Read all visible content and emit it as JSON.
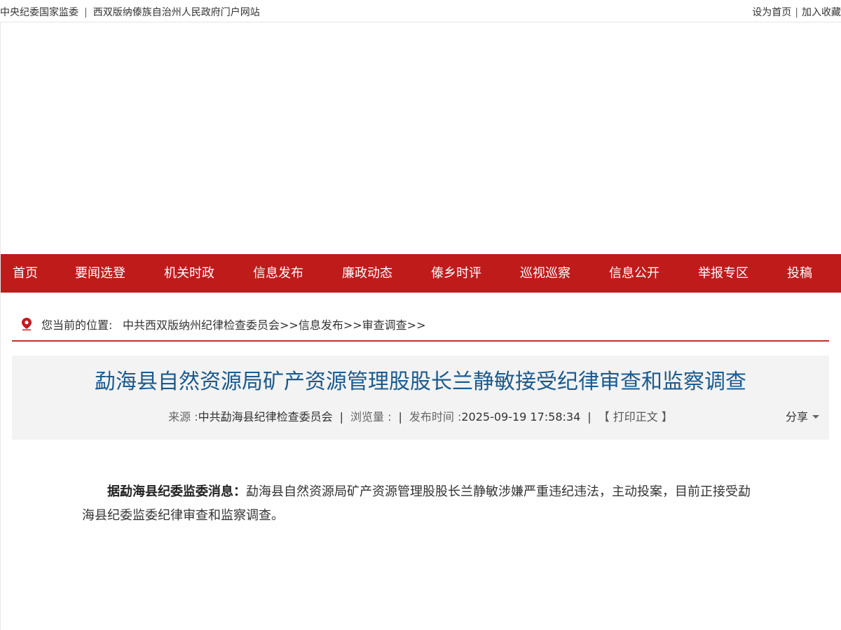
{
  "topbar": {
    "link1": "中央纪委国家监委",
    "separator": "|",
    "link2": "西双版纳傣族自治州人民政府门户网站",
    "set_home": "设为首页",
    "right_sep": "|",
    "add_fav": "加入收藏"
  },
  "nav": {
    "items": [
      "首页",
      "要闻选登",
      "机关时政",
      "信息发布",
      "廉政动态",
      "傣乡时评",
      "巡视巡察",
      "信息公开",
      "举报专区",
      "投稿"
    ]
  },
  "breadcrumb": {
    "label": "您当前的位置:",
    "items": [
      "中共西双版纳州纪律检查委员会",
      "信息发布",
      "审查调查"
    ],
    "sep": ">>"
  },
  "article": {
    "title": "勐海县自然资源局矿产资源管理股股长兰静敏接受纪律审查和监察调查",
    "source_label": "来源 :",
    "source_value": "中共勐海县纪律检查委员会",
    "views_label": "浏览量 :",
    "bar": "|",
    "publish_label": "发布时间 :",
    "publish_value": "2025-09-19 17:58:34",
    "print_label": "【 打印正文 】",
    "share_label": "分享",
    "body_lead": "据勐海县纪委监委消息：",
    "body_text": "勐海县自然资源局矿产资源管理股股长兰静敏涉嫌严重违纪违法，主动投案，目前正接受勐海县纪委监委纪律审查和监察调查。"
  },
  "colors": {
    "nav_bg": "#c01b1b",
    "title": "#1b5a8f",
    "crumb_line": "#b6372a",
    "pin": "#c8161d"
  },
  "icons": {
    "location": "location-pin-icon",
    "share_caret": "caret-down-icon"
  }
}
